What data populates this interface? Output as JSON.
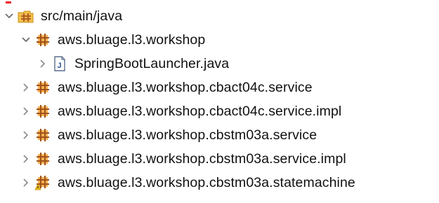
{
  "tree": {
    "root": {
      "label": "src/main/java",
      "expanded": true,
      "icon": "source-folder-icon"
    },
    "items": [
      {
        "label": "aws.bluage.l3.workshop",
        "expanded": true,
        "icon": "package-icon",
        "level": 1
      },
      {
        "label": "SpringBootLauncher.java",
        "expanded": false,
        "icon": "java-file-icon",
        "level": 2
      },
      {
        "label": "aws.bluage.l3.workshop.cbact04c.service",
        "expanded": false,
        "icon": "package-icon",
        "level": 1
      },
      {
        "label": "aws.bluage.l3.workshop.cbact04c.service.impl",
        "expanded": false,
        "icon": "package-icon",
        "level": 1
      },
      {
        "label": "aws.bluage.l3.workshop.cbstm03a.service",
        "expanded": false,
        "icon": "package-icon",
        "level": 1
      },
      {
        "label": "aws.bluage.l3.workshop.cbstm03a.service.impl",
        "expanded": false,
        "icon": "package-icon",
        "level": 1
      },
      {
        "label": "aws.bluage.l3.workshop.cbstm03a.statemachine",
        "expanded": false,
        "icon": "package-icon",
        "level": 1,
        "decorated": true
      }
    ]
  },
  "colors": {
    "chevron": "#7a7a7a",
    "package": "#b5651d",
    "package_fill": "#f0a040",
    "folder": "#e8b23c",
    "error": "#e02020"
  }
}
